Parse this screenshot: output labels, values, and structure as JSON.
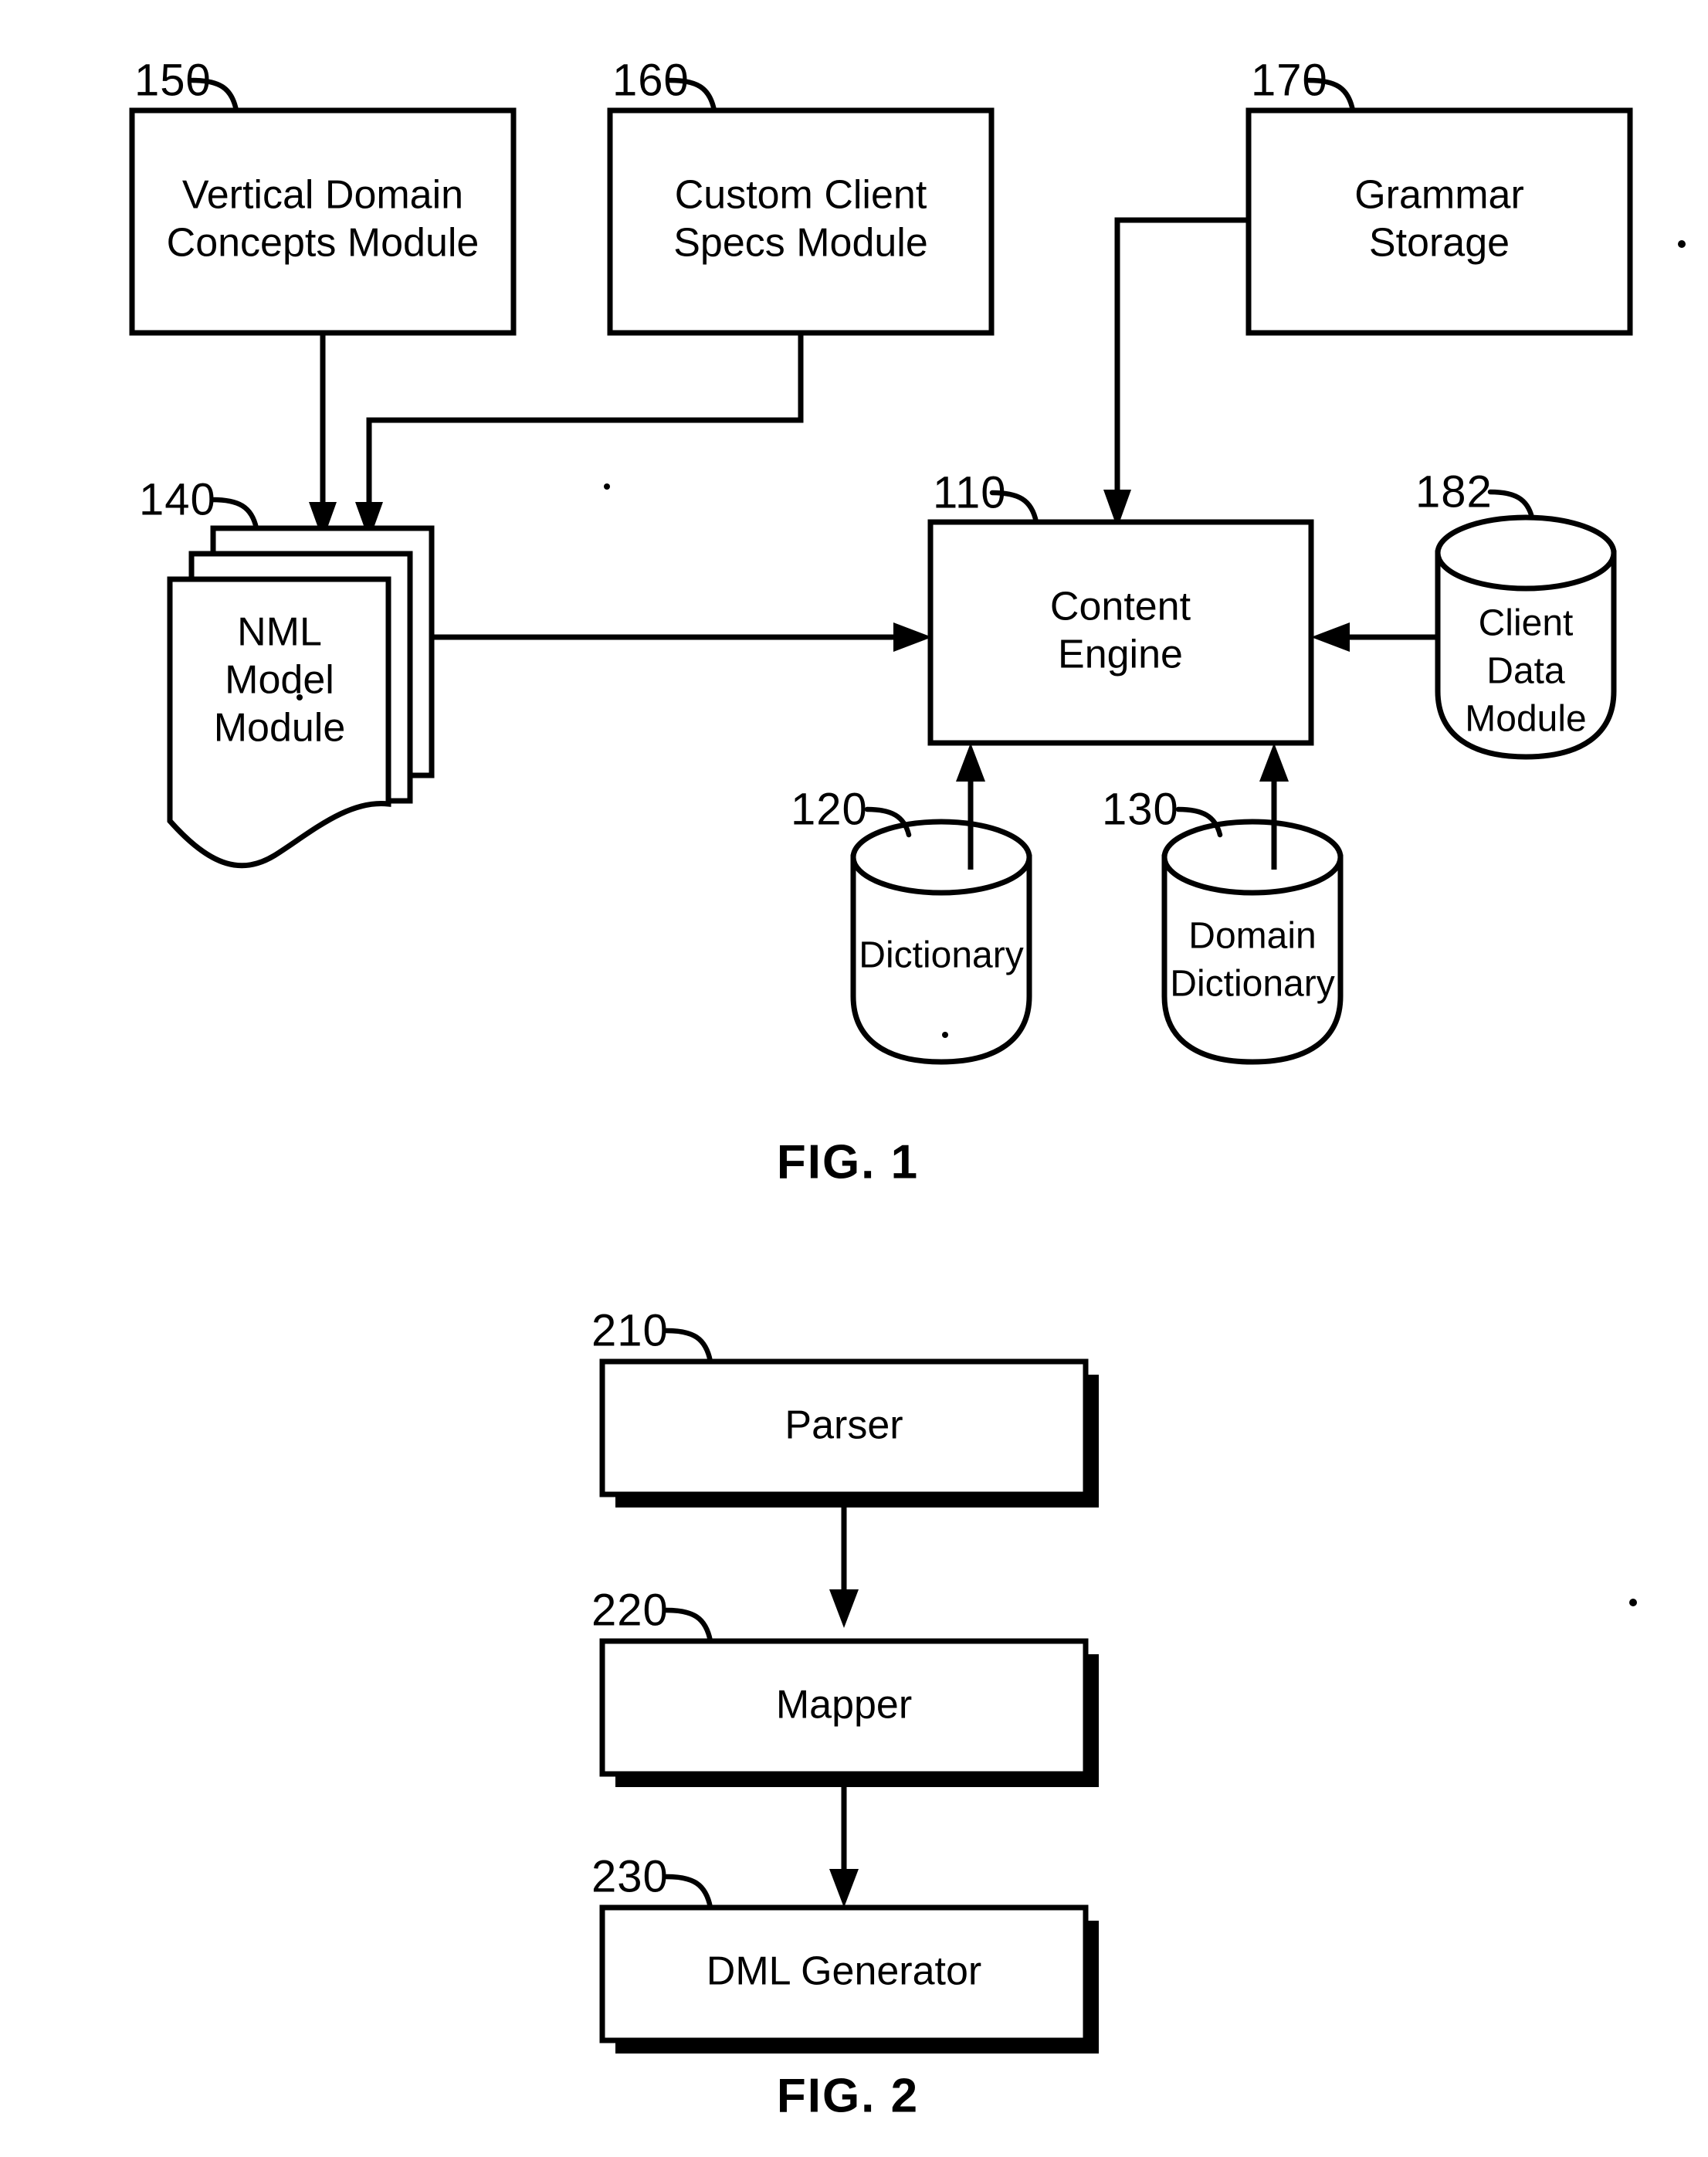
{
  "document": {
    "type": "patent-drawing-sheet",
    "figures": [
      "FIG. 1",
      "FIG. 2"
    ]
  },
  "fig1": {
    "caption": "FIG. 1",
    "nodes": [
      {
        "ref": "150",
        "label_lines": [
          "Vertical Domain",
          "Concepts Module"
        ],
        "shape": "rectangle"
      },
      {
        "ref": "160",
        "label_lines": [
          "Custom Client",
          "Specs Module"
        ],
        "shape": "rectangle"
      },
      {
        "ref": "170",
        "label_lines": [
          "Grammar",
          "Storage"
        ],
        "shape": "rectangle"
      },
      {
        "ref": "140",
        "label_lines": [
          "NML",
          "Model",
          "Module"
        ],
        "shape": "stacked-documents"
      },
      {
        "ref": "110",
        "label_lines": [
          "Content",
          "Engine"
        ],
        "shape": "rectangle"
      },
      {
        "ref": "182",
        "label_lines": [
          "Client",
          "Data",
          "Module"
        ],
        "shape": "cylinder"
      },
      {
        "ref": "120",
        "label_lines": [
          "Dictionary"
        ],
        "shape": "cylinder"
      },
      {
        "ref": "130",
        "label_lines": [
          "Domain",
          "Dictionary"
        ],
        "shape": "cylinder"
      }
    ],
    "edges": [
      {
        "from": "150",
        "to": "140",
        "style": "arrow-down"
      },
      {
        "from": "160",
        "to": "140",
        "style": "arrow-elbow-down"
      },
      {
        "from": "170",
        "to": "110",
        "style": "arrow-elbow-down"
      },
      {
        "from": "140",
        "to": "110",
        "style": "arrow-right"
      },
      {
        "from": "182",
        "to": "110",
        "style": "arrow-left"
      },
      {
        "from": "120",
        "to": "110",
        "style": "arrow-up"
      },
      {
        "from": "130",
        "to": "110",
        "style": "arrow-up"
      }
    ]
  },
  "fig2": {
    "caption": "FIG. 2",
    "nodes": [
      {
        "ref": "210",
        "label_lines": [
          "Parser"
        ],
        "shape": "rectangle-shadow"
      },
      {
        "ref": "220",
        "label_lines": [
          "Mapper"
        ],
        "shape": "rectangle-shadow"
      },
      {
        "ref": "230",
        "label_lines": [
          "DML Generator"
        ],
        "shape": "rectangle-shadow"
      }
    ],
    "edges": [
      {
        "from": "210",
        "to": "220",
        "style": "arrow-down"
      },
      {
        "from": "220",
        "to": "230",
        "style": "arrow-down"
      }
    ]
  },
  "colors": {
    "ink": "#000000",
    "paper": "#ffffff"
  }
}
